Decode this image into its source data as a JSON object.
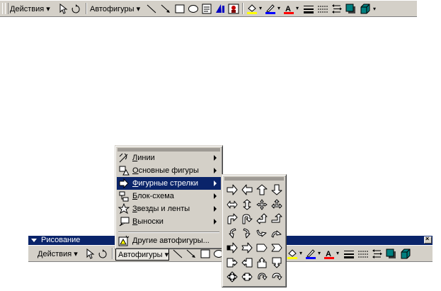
{
  "top_toolbar": {
    "actions_label": "Действия",
    "autoshapes_label": "Автофигуры"
  },
  "drawing_window": {
    "title": "Рисование",
    "close_glyph": "×",
    "actions_label": "Действия",
    "autoshapes_label": "Автофигуры"
  },
  "autoshapes_menu": {
    "items": [
      {
        "label": "Линии",
        "icon": "lines-icon",
        "submenu": true
      },
      {
        "label": "Основные фигуры",
        "icon": "basic-shapes-icon",
        "submenu": true
      },
      {
        "label": "Фигурные стрелки",
        "icon": "block-arrows-icon",
        "submenu": true,
        "highlighted": true
      },
      {
        "label": "Блок-схема",
        "icon": "flowchart-icon",
        "submenu": true
      },
      {
        "label": "Звезды и ленты",
        "icon": "stars-banners-icon",
        "submenu": true
      },
      {
        "label": "Выноски",
        "icon": "callouts-icon",
        "submenu": true
      }
    ],
    "more_label": "Другие автофигуры..."
  },
  "block_arrows_palette": {
    "rows": [
      [
        "right-arrow-icon",
        "left-arrow-icon",
        "up-arrow-icon",
        "down-arrow-icon"
      ],
      [
        "left-right-arrow-icon",
        "up-down-arrow-icon",
        "quad-arrow-icon",
        "left-right-up-arrow-icon"
      ],
      [
        "bent-arrow-icon",
        "u-turn-arrow-icon",
        "left-up-arrow-icon",
        "bent-up-arrow-icon"
      ],
      [
        "curved-right-arrow-icon",
        "curved-left-arrow-icon",
        "curved-up-arrow-icon",
        "curved-down-arrow-icon"
      ],
      [
        "striped-right-arrow-icon",
        "notched-right-arrow-icon",
        "pentagon-icon",
        "chevron-icon"
      ],
      [
        "right-arrow-callout-icon",
        "left-arrow-callout-icon",
        "up-arrow-callout-icon",
        "down-arrow-callout-icon"
      ],
      [
        "quad-arrow-callout-icon",
        "left-right-arrow-callout-icon",
        "circular-arrow-icon",
        "curved-arrow-icon"
      ]
    ]
  },
  "colors": {
    "toolbar_bg": "#d4d0c8",
    "highlight": "#0a246a",
    "fill_yellow": "#ffff00",
    "line_blue": "#0000ff",
    "font_red": "#ff0000"
  }
}
